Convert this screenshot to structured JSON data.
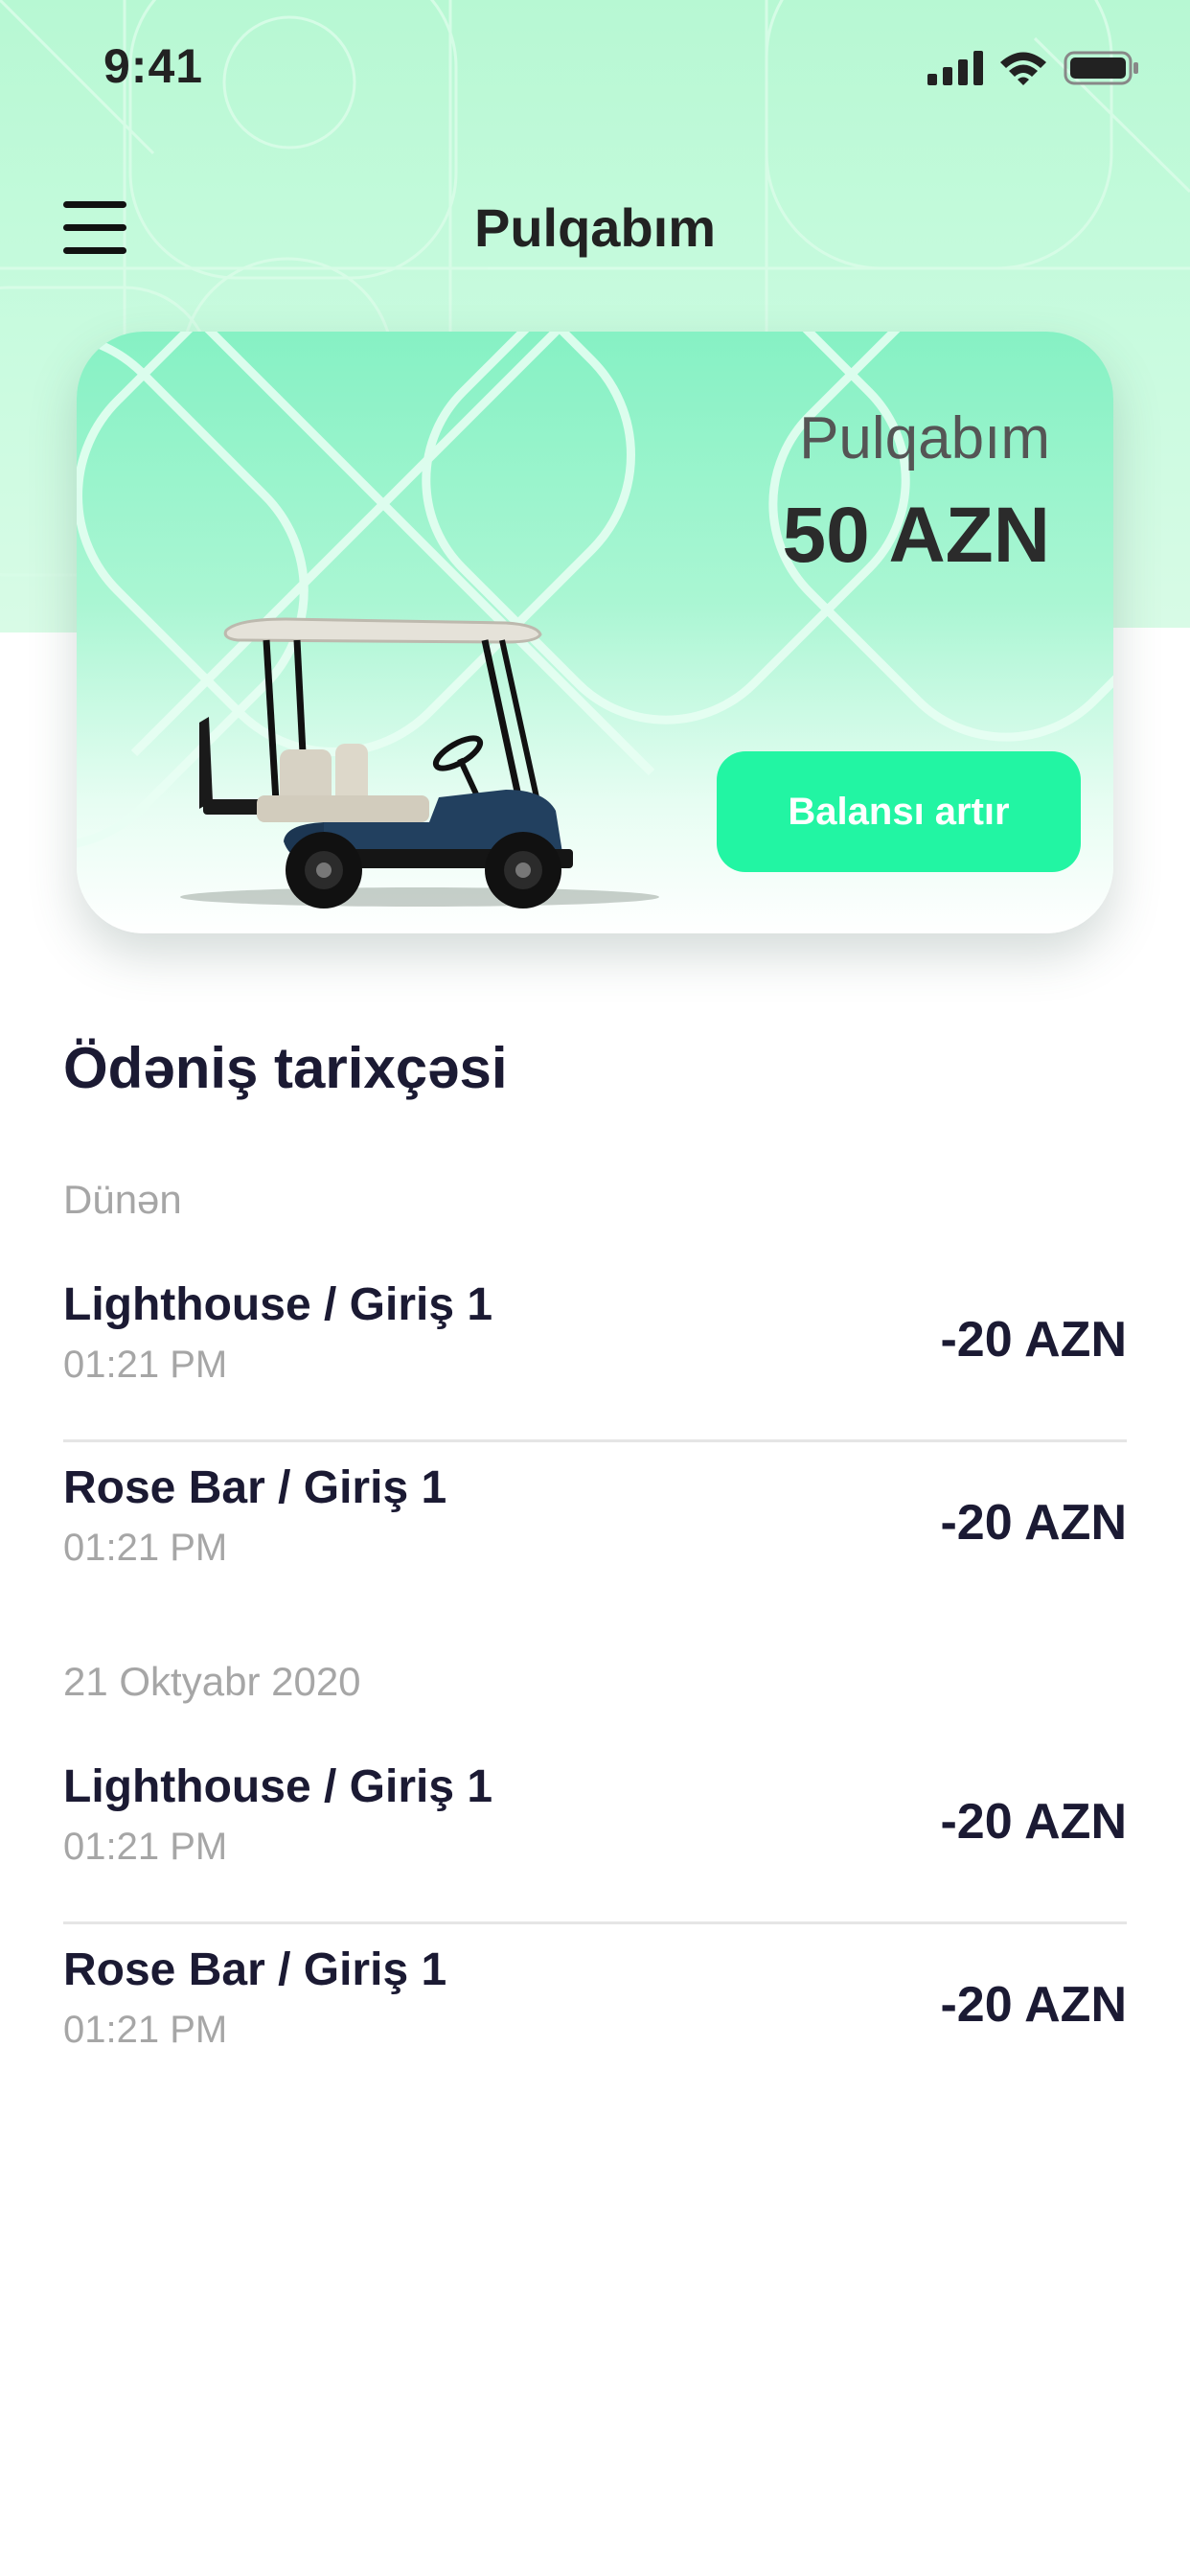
{
  "status_bar": {
    "time": "9:41"
  },
  "header": {
    "title": "Pulqabım"
  },
  "wallet_card": {
    "label": "Pulqabım",
    "balance": "50 AZN",
    "topup_label": "Balansı artır"
  },
  "history": {
    "title": "Ödəniş tarixçəsi",
    "groups": [
      {
        "date": "Dünən",
        "items": [
          {
            "title": "Lighthouse / Giriş 1",
            "time": "01:21 PM",
            "amount": "-20 AZN"
          },
          {
            "title": "Rose Bar / Giriş 1",
            "time": "01:21 PM",
            "amount": "-20 AZN"
          }
        ]
      },
      {
        "date": "21 Oktyabr 2020",
        "items": [
          {
            "title": "Lighthouse / Giriş 1",
            "time": "01:21 PM",
            "amount": "-20 AZN"
          },
          {
            "title": "Rose Bar / Giriş 1",
            "time": "01:21 PM",
            "amount": "-20 AZN"
          }
        ]
      }
    ]
  },
  "colors": {
    "accent": "#22f5a3",
    "card_top": "#86f1c4",
    "header_bg": "#b7f8d3",
    "text_dark": "#1b1a33",
    "text_muted": "#a6a6a6"
  },
  "icons": {
    "menu": "hamburger-menu-icon",
    "signal": "cellular-signal-icon",
    "wifi": "wifi-icon",
    "battery": "battery-icon",
    "illustration": "golf-cart-illustration"
  }
}
